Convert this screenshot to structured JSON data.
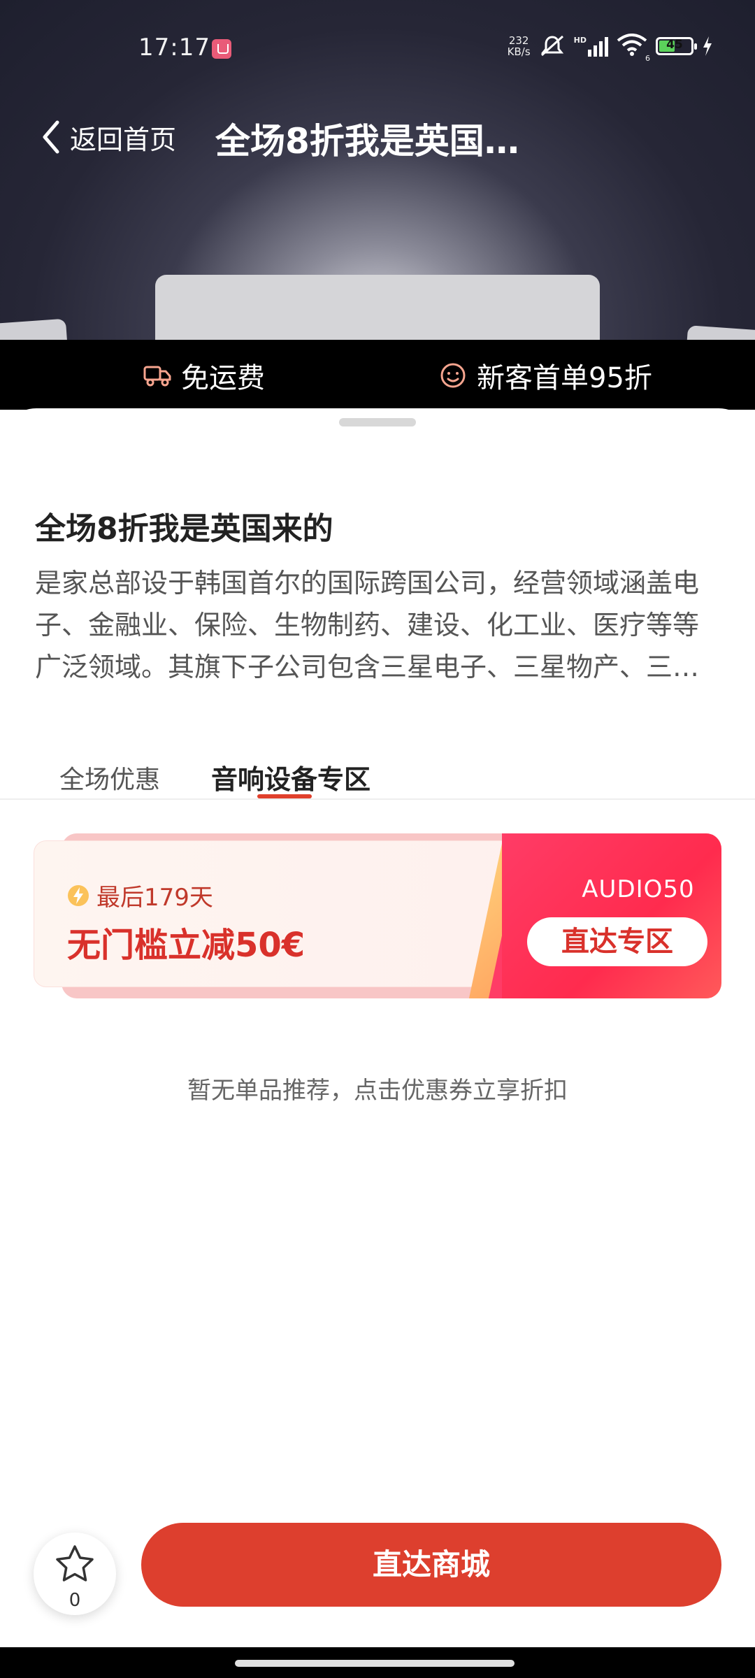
{
  "status_bar": {
    "time": "17:17",
    "net_speed_value": "232",
    "net_speed_unit": "KB/s",
    "network_label": "HD",
    "wifi_label": "6",
    "battery": "45"
  },
  "header": {
    "back_label": "返回首页",
    "title": "全场8折我是英国…"
  },
  "perks": [
    {
      "label": "免运费",
      "icon": "truck-icon"
    },
    {
      "label": "新客首单95折",
      "icon": "smile-icon"
    }
  ],
  "store": {
    "name": "全场8折我是英国来的",
    "description": "是家总部设于韩国首尔的国际跨国公司，经营领域涵盖电子、金融业、保险、生物制药、建设、化工业、医疗等等广泛领域。其旗下子公司包含三星电子、三星物产、三星生命等。"
  },
  "tabs": [
    {
      "label": "全场优惠",
      "active": false
    },
    {
      "label": "音响设备专区",
      "active": true
    }
  ],
  "coupon": {
    "expire": "最后179天",
    "amount": "无门槛立减50€",
    "code": "AUDIO50",
    "button": "直达专区"
  },
  "empty_hint": "暂无单品推荐，点击优惠券立享折扣",
  "bottom": {
    "favorite_count": "0",
    "mall_button": "直达商城"
  },
  "colors": {
    "accent": "#dd3f2e",
    "coupon_red": "#ff2b4e"
  }
}
